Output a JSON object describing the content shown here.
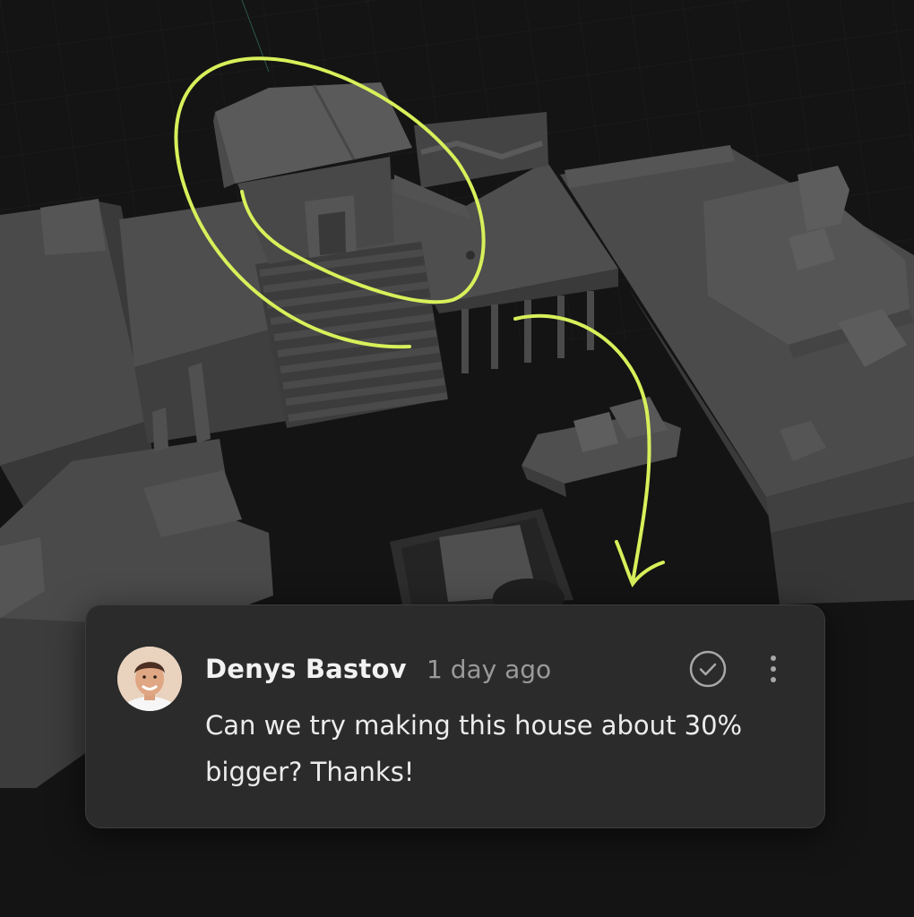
{
  "comment": {
    "author": "Denys Bastov",
    "timestamp": "1 day ago",
    "text": "Can we try making this house about 30% bigger? Thanks!"
  },
  "icons": {
    "avatar": "user-avatar-photo",
    "resolve": "check-circle-icon",
    "more": "more-vertical-icon"
  },
  "colors": {
    "annotation": "#d8f05a",
    "card_background": "#2b2b2b",
    "scene_background": "#141414"
  }
}
